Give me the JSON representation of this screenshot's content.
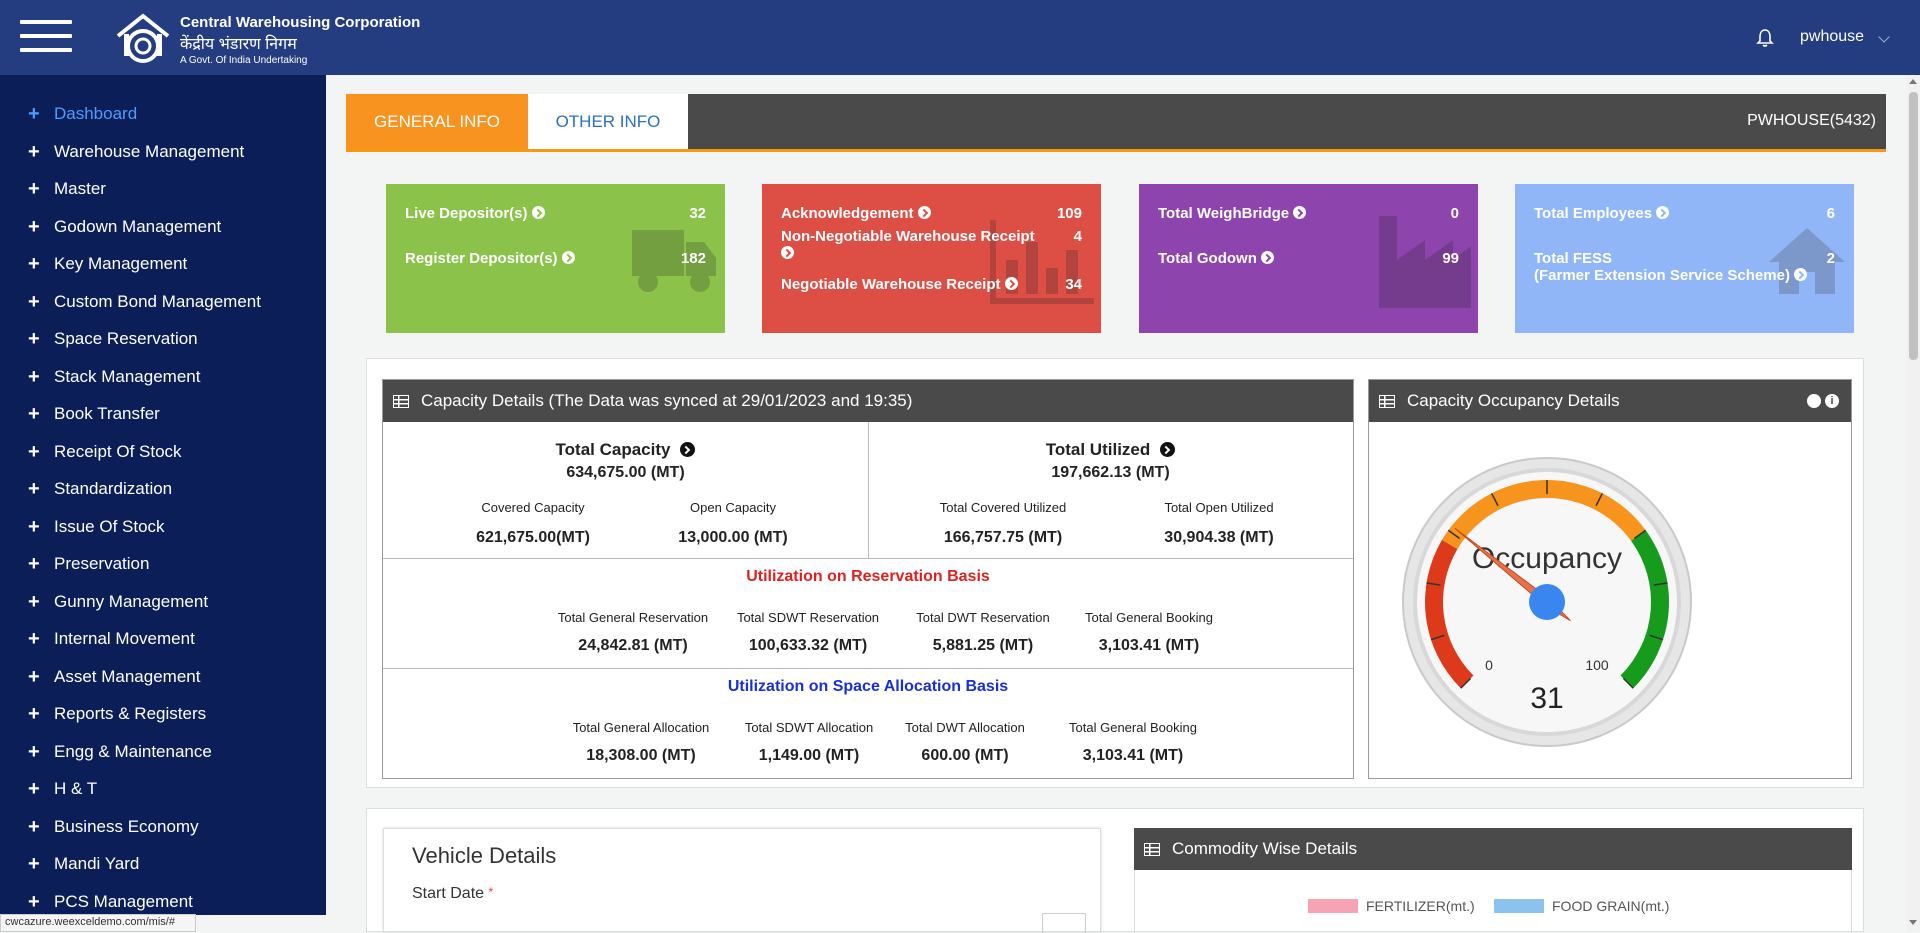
{
  "header": {
    "org_en": "Central Warehousing Corporation",
    "org_hi": "केंद्रीय भंडारण निगम",
    "org_tagline": "A Govt. Of India Undertaking",
    "username": "pwhouse"
  },
  "sidebar": {
    "items": [
      {
        "label": "Dashboard",
        "active": true
      },
      {
        "label": "Warehouse Management"
      },
      {
        "label": "Master"
      },
      {
        "label": "Godown Management"
      },
      {
        "label": "Key Management"
      },
      {
        "label": "Custom Bond Management"
      },
      {
        "label": "Space Reservation"
      },
      {
        "label": "Stack Management"
      },
      {
        "label": "Book Transfer"
      },
      {
        "label": "Receipt Of Stock"
      },
      {
        "label": "Standardization"
      },
      {
        "label": "Issue Of Stock"
      },
      {
        "label": "Preservation"
      },
      {
        "label": "Gunny Management"
      },
      {
        "label": "Internal Movement"
      },
      {
        "label": "Asset Management"
      },
      {
        "label": "Reports & Registers"
      },
      {
        "label": "Engg & Maintenance"
      },
      {
        "label": "H & T"
      },
      {
        "label": "Business Economy"
      },
      {
        "label": "Mandi Yard"
      },
      {
        "label": "PCS Management"
      }
    ]
  },
  "status_url": "cwcazure.weexceldemo.com/mis/#",
  "tabs": {
    "general": "GENERAL INFO",
    "other": "OTHER INFO",
    "code": "PWHOUSE(5432)"
  },
  "cards": {
    "green": {
      "r1_label": "Live Depositor(s)",
      "r1_value": "32",
      "r2_label": "Register Depositor(s)",
      "r2_value": "182",
      "color": "#8bc34a"
    },
    "red": {
      "r1_label": "Acknowledgement",
      "r1_value": "109",
      "r2_label": "Non-Negotiable Warehouse Receipt",
      "r2_value": "4",
      "r3_label": "Negotiable Warehouse Receipt",
      "r3_value": "34",
      "color": "#dd4f45"
    },
    "purple": {
      "r1_label": "Total WeighBridge",
      "r1_value": "0",
      "r2_label": "Total Godown",
      "r2_value": "99",
      "color": "#8e44ad"
    },
    "blue": {
      "r1_label": "Total Employees",
      "r1_value": "6",
      "r2_label": "Total FESS",
      "r2_value": "2",
      "r2_sub": "(Farmer Extension Service Scheme)",
      "color": "#91b6f7"
    }
  },
  "capacity": {
    "heading": "Capacity Details (The Data was synced at 29/01/2023 and 19:35)",
    "total_capacity_label": "Total Capacity",
    "total_capacity_value": "634,675.00 (MT)",
    "covered_capacity_label": "Covered Capacity",
    "covered_capacity_value": "621,675.00(MT)",
    "open_capacity_label": "Open Capacity",
    "open_capacity_value": "13,000.00 (MT)",
    "total_utilized_label": "Total Utilized",
    "total_utilized_value": "197,662.13 (MT)",
    "covered_utilized_label": "Total Covered Utilized",
    "covered_utilized_value": "166,757.75 (MT)",
    "open_utilized_label": "Total Open Utilized",
    "open_utilized_value": "30,904.38 (MT)",
    "reservation": {
      "title": "Utilization on Reservation Basis",
      "items": [
        {
          "label": "Total General Reservation",
          "value": "24,842.81 (MT)"
        },
        {
          "label": "Total SDWT Reservation",
          "value": "100,633.32 (MT)"
        },
        {
          "label": "Total DWT Reservation",
          "value": "5,881.25 (MT)"
        },
        {
          "label": "Total General Booking",
          "value": "3,103.41 (MT)"
        }
      ]
    },
    "allocation": {
      "title": "Utilization on Space Allocation Basis",
      "items": [
        {
          "label": "Total General Allocation",
          "value": "18,308.00 (MT)"
        },
        {
          "label": "Total SDWT Allocation",
          "value": "1,149.00 (MT)"
        },
        {
          "label": "Total DWT Allocation",
          "value": "600.00 (MT)"
        },
        {
          "label": "Total General Booking",
          "value": "3,103.41 (MT)"
        }
      ]
    }
  },
  "occupancy": {
    "heading": "Capacity Occupancy Details",
    "gauge_title": "Occupancy",
    "min": "0",
    "max": "100",
    "value": "31",
    "value_num": 31
  },
  "vehicle": {
    "title": "Vehicle Details",
    "start_date_label": "Start Date",
    "required_mark": "*"
  },
  "commodity": {
    "heading": "Commodity Wise Details",
    "legend": [
      {
        "label": "FERTILIZER(mt.)",
        "color": "#f6a3b3"
      },
      {
        "label": "FOOD GRAIN(mt.)",
        "color": "#8cc3ee"
      }
    ]
  }
}
